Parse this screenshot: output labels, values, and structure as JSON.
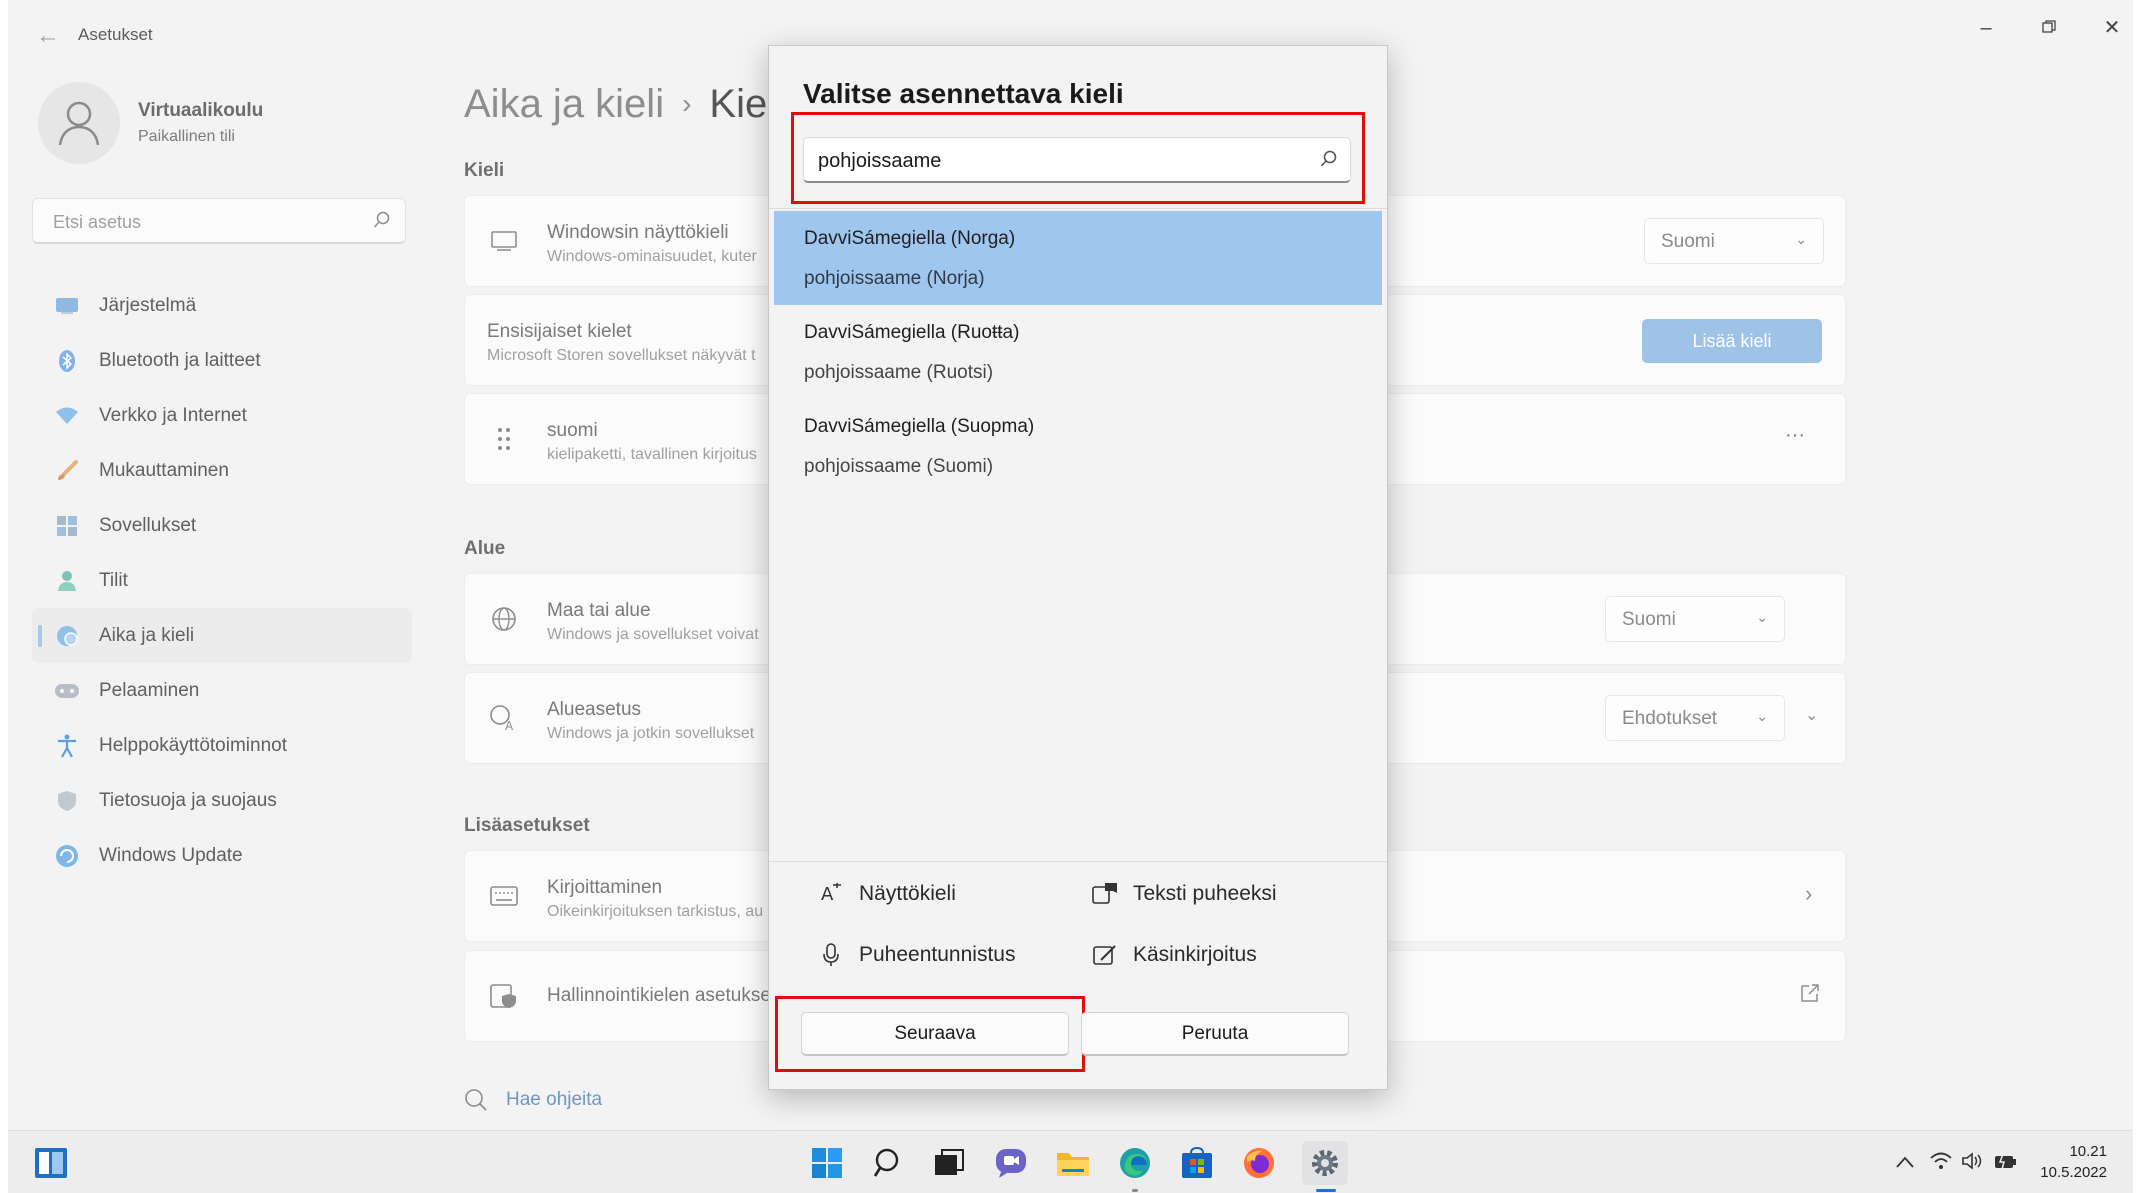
{
  "window": {
    "app_title": "Asetukset",
    "back_icon": "back-arrow-icon",
    "controls": [
      "minimize-icon",
      "restore-icon",
      "close-icon"
    ]
  },
  "profile": {
    "name": "Virtuaalikoulu",
    "account_type": "Paikallinen tili"
  },
  "sidebar": {
    "search_placeholder": "Etsi asetus",
    "items": [
      {
        "label": "Järjestelmä",
        "icon": "system-icon"
      },
      {
        "label": "Bluetooth ja laitteet",
        "icon": "bluetooth-icon"
      },
      {
        "label": "Verkko ja Internet",
        "icon": "wifi-icon"
      },
      {
        "label": "Mukauttaminen",
        "icon": "brush-icon"
      },
      {
        "label": "Sovellukset",
        "icon": "apps-icon"
      },
      {
        "label": "Tilit",
        "icon": "person-icon"
      },
      {
        "label": "Aika ja kieli",
        "icon": "globe-clock-icon",
        "active": true
      },
      {
        "label": "Pelaaminen",
        "icon": "gamepad-icon"
      },
      {
        "label": "Helppokäyttötoiminnot",
        "icon": "accessibility-icon"
      },
      {
        "label": "Tietosuoja ja suojaus",
        "icon": "shield-icon"
      },
      {
        "label": "Windows Update",
        "icon": "update-icon"
      }
    ]
  },
  "main": {
    "breadcrumb": {
      "parent": "Aika ja kieli",
      "separator": "›",
      "current": "Kie"
    },
    "sections": {
      "language": "Kieli",
      "region": "Alue",
      "additional": "Lisäasetukset"
    },
    "cards": {
      "display_language": {
        "title": "Windowsin näyttökieli",
        "subtitle": "Windows-ominaisuudet, kuter",
        "value": "Suomi"
      },
      "preferred_languages": {
        "title": "Ensisijaiset kielet",
        "subtitle": "Microsoft Storen sovellukset näkyvät t",
        "button": "Lisää kieli"
      },
      "suomi": {
        "title": "suomi",
        "subtitle": "kielipaketti, tavallinen kirjoitus",
        "more": "···"
      },
      "country": {
        "title": "Maa tai alue",
        "subtitle": "Windows ja sovellukset voivat",
        "value": "Suomi"
      },
      "regional_format": {
        "title": "Alueasetus",
        "subtitle": "Windows ja jotkin sovellukset",
        "value": "Ehdotukset"
      },
      "typing": {
        "title": "Kirjoittaminen",
        "subtitle": "Oikeinkirjoituksen tarkistus, au"
      },
      "admin_language": {
        "title": "Hallinnointikielen asetukse"
      }
    },
    "help_link": "Hae ohjeita"
  },
  "dialog": {
    "title": "Valitse asennettava kieli",
    "search_value": "pohjoissaame",
    "languages": [
      {
        "native": "DavviSámegiella (Norga)",
        "finnish": "pohjoissaame (Norja)",
        "selected": true
      },
      {
        "native": "DavviSámegiella (Ruoŧŧa)",
        "finnish": "pohjoissaame (Ruotsi)",
        "selected": false
      },
      {
        "native": "DavviSámegiella (Suopma)",
        "finnish": "pohjoissaame (Suomi)",
        "selected": false
      }
    ],
    "features": [
      {
        "label": "Näyttökieli",
        "icon": "display-language-icon"
      },
      {
        "label": "Teksti puheeksi",
        "icon": "text-to-speech-icon"
      },
      {
        "label": "Puheentunnistus",
        "icon": "microphone-icon"
      },
      {
        "label": "Käsinkirjoitus",
        "icon": "handwriting-icon"
      }
    ],
    "next_button": "Seuraava",
    "cancel_button": "Peruuta"
  },
  "taskbar": {
    "time": "10.21",
    "date": "10.5.2022"
  },
  "colors": {
    "selection": "#9fc6ee",
    "accent_button": "#9ec3e6",
    "highlight_box": "#e00d0d"
  }
}
